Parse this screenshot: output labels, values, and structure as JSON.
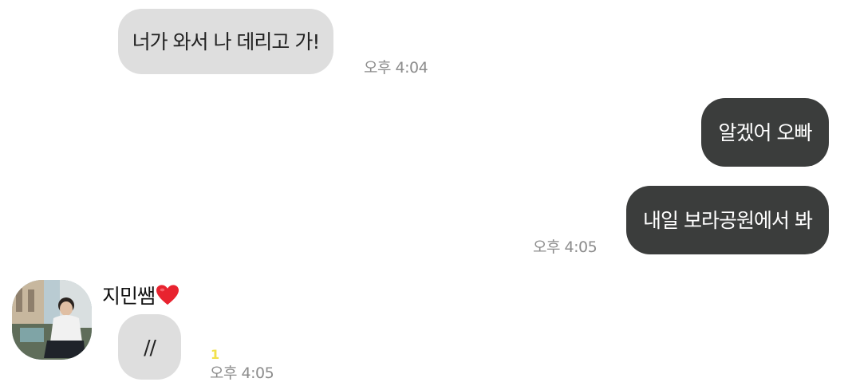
{
  "messages": [
    {
      "id": "m1",
      "direction": "incoming",
      "text": "너가 와서 나 데리고 가!",
      "time": "오후 4:04"
    },
    {
      "id": "m2",
      "direction": "outgoing",
      "text": "알겠어 오빠",
      "time": ""
    },
    {
      "id": "m3",
      "direction": "outgoing",
      "text": "내일 보라공원에서 봐",
      "time": "오후 4:05"
    },
    {
      "id": "m4",
      "direction": "incoming",
      "sender": "지민쌤",
      "text": "//",
      "time": "오후 4:05",
      "unread_count": "1"
    }
  ],
  "sender_heart": "heart-icon",
  "colors": {
    "incoming_bubble": "#dedede",
    "outgoing_bubble": "#3b3d3c",
    "unread": "#f2e14c",
    "timestamp": "#8c8c8c"
  }
}
